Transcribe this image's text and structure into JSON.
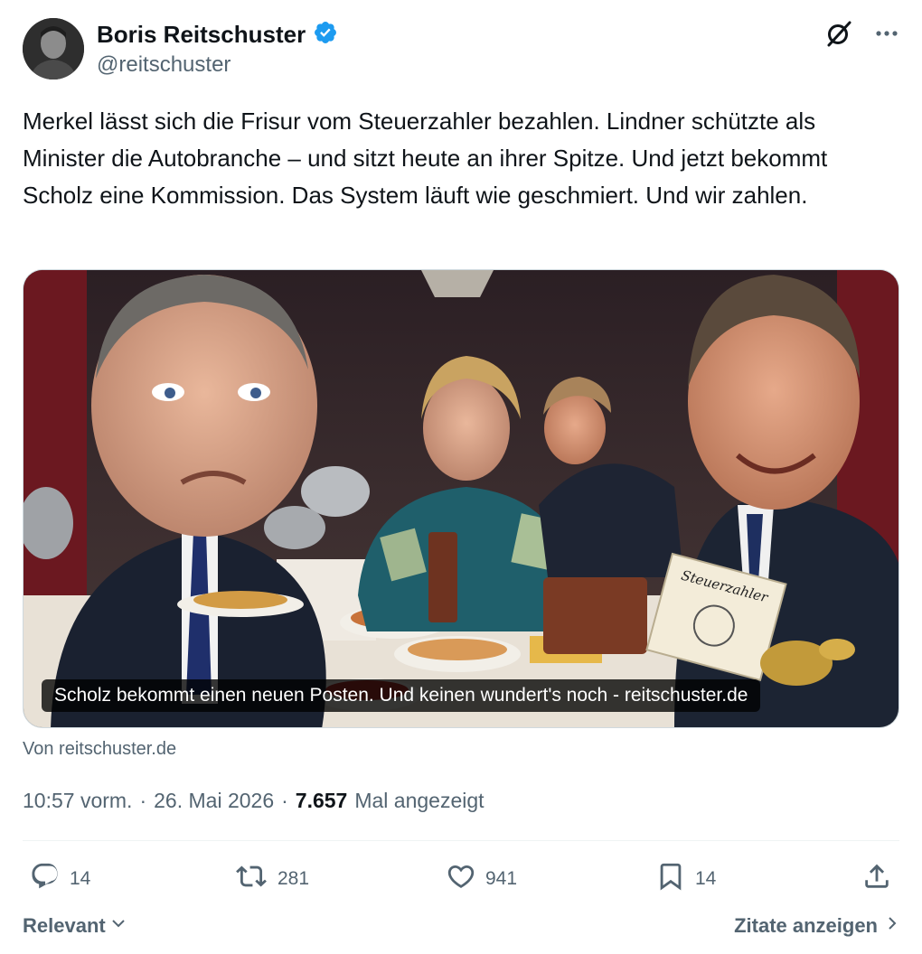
{
  "author": {
    "name": "Boris Reitschuster",
    "handle": "@reitschuster",
    "verified": true,
    "verified_color": "#1d9bf0"
  },
  "tweet": {
    "text": "Merkel lässt sich die Frisur vom Steuerzahler bezahlen. Lindner schützte als Minister die Autobranche – und sitzt heute an ihrer Spitze. Und jetzt bekommt Scholz eine Kommission. Das System läuft wie geschmiert. Und wir zahlen.",
    "card_caption": "Scholz bekommt einen neuen Posten. Und keinen wundert's noch - reitschuster.de",
    "card_image_text": "Steuerzahler",
    "card_source": "Von reitschuster.de"
  },
  "meta": {
    "time": "10:57 vorm.",
    "separator": "·",
    "date": "26. Mai 2026",
    "views": "7.657",
    "views_label": "Mal angezeigt"
  },
  "actions": {
    "replies": "14",
    "reposts": "281",
    "likes": "941",
    "bookmarks": "14"
  },
  "footer": {
    "sort_label": "Relevant",
    "quotes_label": "Zitate anzeigen"
  },
  "icons": {
    "avatar": "avatar",
    "verified": "verified-badge-icon",
    "grok": "grok-icon",
    "more": "more-icon",
    "reply": "reply-icon",
    "repost": "repost-icon",
    "like": "heart-icon",
    "bookmark": "bookmark-icon",
    "share": "share-icon",
    "sort": "chevron-down-icon",
    "quotes": "chevron-right-icon"
  },
  "colors": {
    "text_primary": "#0f1419",
    "text_secondary": "#536471",
    "divider": "#eff3f4"
  }
}
